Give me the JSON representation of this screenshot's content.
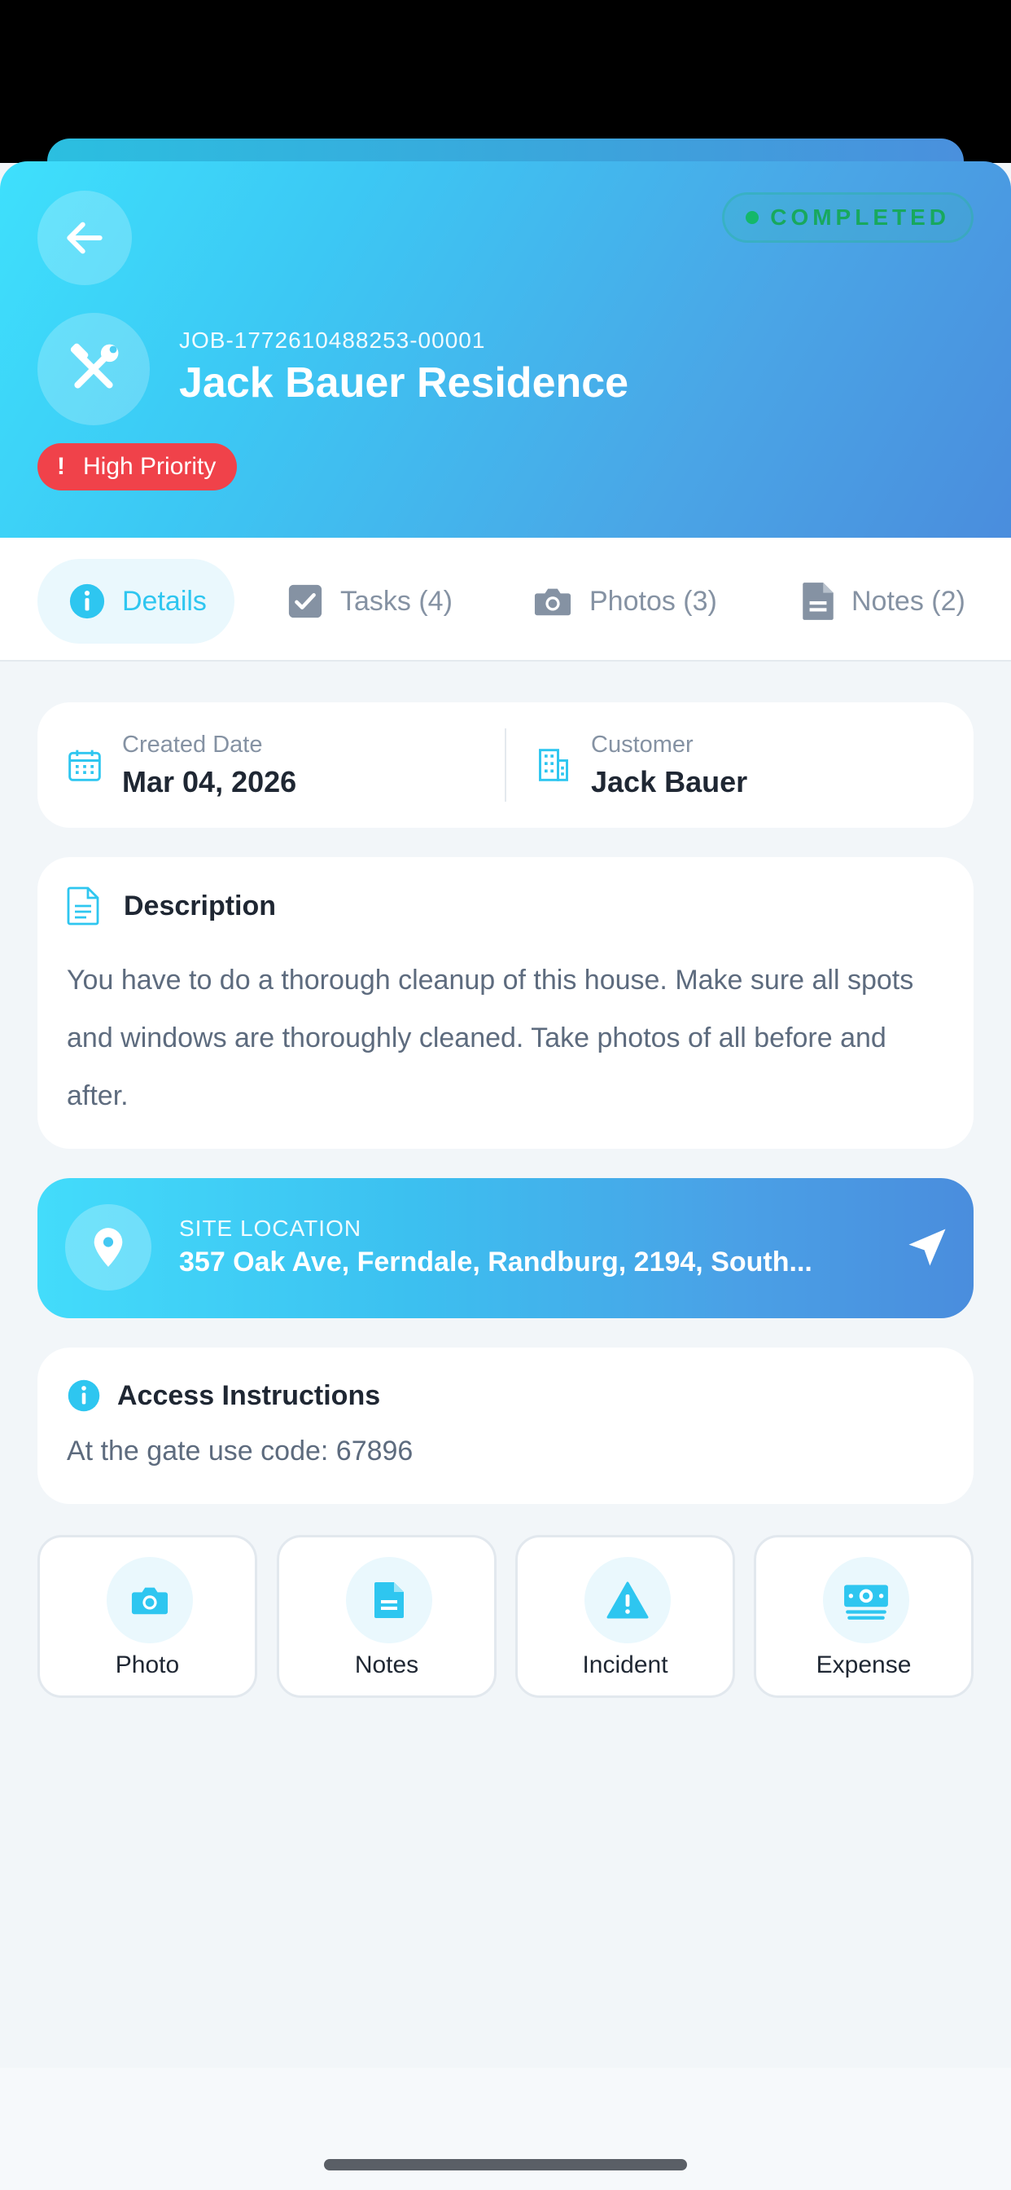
{
  "header": {
    "status": "COMPLETED",
    "job_number": "JOB-1772610488253-00001",
    "title": "Jack Bauer Residence",
    "priority": "High Priority",
    "priority_mark": "!",
    "gradient_start": "#3ee0fc",
    "gradient_end": "#4a8ddd",
    "back_icon": "arrow-left-icon",
    "job_icon": "tools-icon"
  },
  "tabs": [
    {
      "label": "Details",
      "icon": "info-icon",
      "active": true
    },
    {
      "label": "Tasks (4)",
      "icon": "checkbox-icon",
      "active": false
    },
    {
      "label": "Photos (3)",
      "icon": "camera-icon",
      "active": false
    },
    {
      "label": "Notes (2)",
      "icon": "document-icon",
      "active": false
    }
  ],
  "info": {
    "created_label": "Created Date",
    "created_value": "Mar 04, 2026",
    "customer_label": "Customer",
    "customer_value": "Jack Bauer"
  },
  "description": {
    "title": "Description",
    "text": "You have to do a thorough cleanup of this house. Make sure all spots and windows are thoroughly cleaned. Take photos of all before and after."
  },
  "location": {
    "label": "SITE LOCATION",
    "address": "357 Oak Ave, Ferndale, Randburg, 2194, South..."
  },
  "access": {
    "title": "Access Instructions",
    "text": "At the gate use code: 67896"
  },
  "actions": [
    {
      "label": "Photo",
      "icon": "camera-icon"
    },
    {
      "label": "Notes",
      "icon": "document-icon"
    },
    {
      "label": "Incident",
      "icon": "warning-icon"
    },
    {
      "label": "Expense",
      "icon": "money-icon"
    }
  ],
  "colors": {
    "accent": "#2ec6f0",
    "priority": "#f0424a",
    "status": "#18a85e"
  }
}
